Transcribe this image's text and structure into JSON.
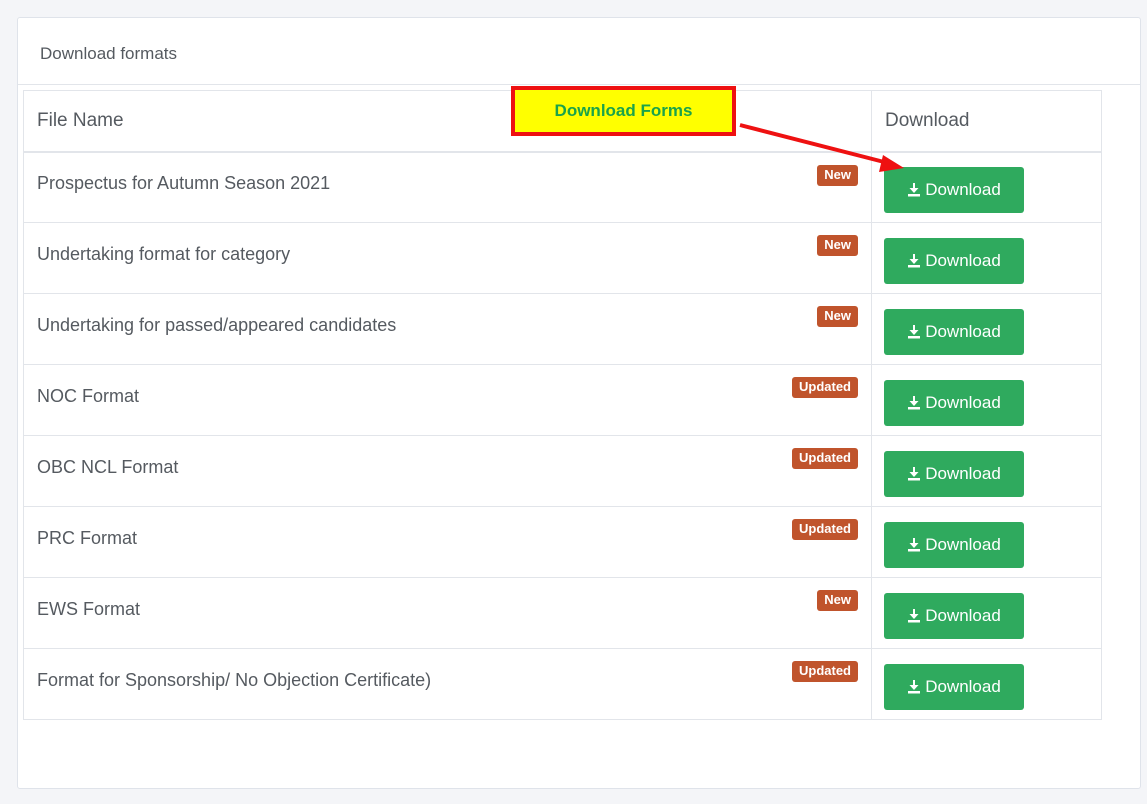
{
  "panel": {
    "title": "Download formats"
  },
  "table": {
    "headers": {
      "file_name": "File Name",
      "download": "Download"
    },
    "rows": [
      {
        "name": "Prospectus for Autumn Season 2021",
        "badge": "New",
        "button": "Download"
      },
      {
        "name": "Undertaking format for category",
        "badge": "New",
        "button": "Download"
      },
      {
        "name": "Undertaking for passed/appeared candidates",
        "badge": "New",
        "button": "Download"
      },
      {
        "name": "NOC Format",
        "badge": "Updated",
        "button": "Download"
      },
      {
        "name": "OBC NCL Format",
        "badge": "Updated",
        "button": "Download"
      },
      {
        "name": "PRC Format",
        "badge": "Updated",
        "button": "Download"
      },
      {
        "name": "EWS Format",
        "badge": "New",
        "button": "Download"
      },
      {
        "name": "Format for Sponsorship/ No Objection Certificate)",
        "badge": "Updated",
        "button": "Download"
      }
    ]
  },
  "annotation": {
    "label": "Download Forms"
  },
  "colors": {
    "button_green": "#2faa5e",
    "badge_orange": "#c0542c",
    "callout_yellow": "#ffff00",
    "callout_border_red": "#ee1111",
    "callout_text_green": "#1aa34a"
  },
  "icons": {
    "download": "download-icon"
  }
}
